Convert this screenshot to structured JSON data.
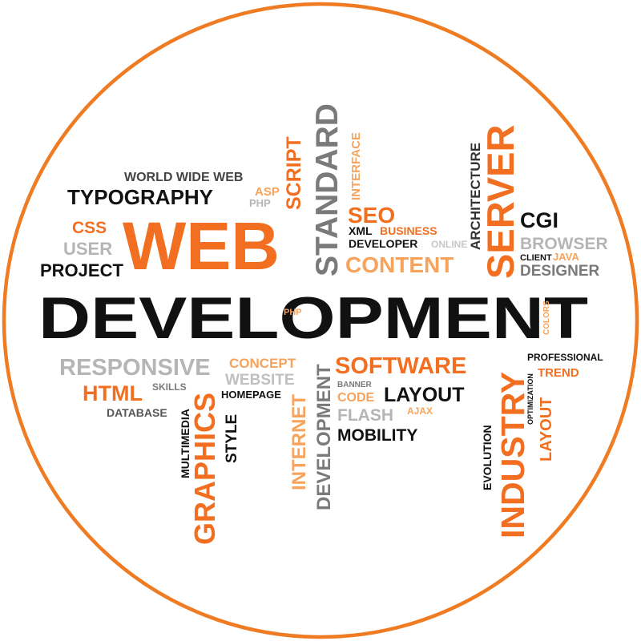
{
  "colors": {
    "orange": "#f26f21",
    "light_orange": "#f7a35c",
    "black": "#111111",
    "gray": "#7a7a7a",
    "light_gray": "#b5b5b5",
    "ring": "#ef7b22"
  },
  "words": {
    "world_wide_web": "WORLD WIDE WEB",
    "typography": "TYPOGRAPHY",
    "asp": "ASP",
    "php_top": "PHP",
    "script": "SCRIPT",
    "standard": "STANDARD",
    "interface": "INTERFACE",
    "css": "CSS",
    "user": "USER",
    "project": "PROJECT",
    "web": "WEB",
    "seo": "SEO",
    "xml": "XML",
    "business": "BUSINESS",
    "developer": "DEVELOPER",
    "online": "ONLINE",
    "content": "CONTENT",
    "architecture": "ARCHITECTURE",
    "server": "SERVER",
    "cgi": "CGI",
    "browser": "BROWSER",
    "client": "CLIENT",
    "java": "JAVA",
    "designer": "DESIGNER",
    "development_main": "DEVELOPMENT",
    "php_mid": "PHP",
    "colors": "COLORS",
    "responsive": "RESPONSIVE",
    "concept": "CONCEPT",
    "website": "WEBSITE",
    "html": "HTML",
    "skills": "SKILLS",
    "homepage": "HOMEPAGE",
    "database": "DATABASE",
    "multimedia": "MULTIMEDIA",
    "graphics": "GRAPHICS",
    "style": "STYLE",
    "internet": "INTERNET",
    "development_vertical": "DEVELOPMENT",
    "software": "SOFTWARE",
    "banner": "BANNER",
    "code": "CODE",
    "layout_main": "LAYOUT",
    "flash": "FLASH",
    "ajax": "AJAX",
    "mobility": "MOBILITY",
    "evolution": "EVOLUTION",
    "industry": "INDUSTRY",
    "optimization": "OPTIMIZATION",
    "layout_vertical": "LAYOUT",
    "professional": "PROFESSIONAL",
    "trend": "TREND"
  }
}
